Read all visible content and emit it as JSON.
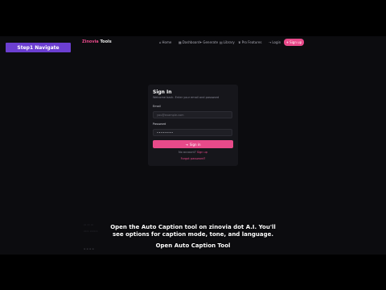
{
  "step": {
    "label": "Step1 Navigate"
  },
  "brand": {
    "part1": "Zinovia",
    "part2": "Tools"
  },
  "nav": {
    "links": [
      {
        "icon": "home-icon",
        "glyph": "⌂",
        "label": "Home"
      },
      {
        "icon": "dashboard-icon",
        "glyph": "▦",
        "label": "Dashboard"
      },
      {
        "icon": "generate-icon",
        "glyph": "✦",
        "label": "Generate"
      },
      {
        "icon": "library-icon",
        "glyph": "▤",
        "label": "Library"
      },
      {
        "icon": "pro-icon",
        "glyph": "♛",
        "label": "Pro Features"
      }
    ],
    "login": "Login",
    "signup": "Sign up"
  },
  "card": {
    "title": "Sign In",
    "subtitle": "Welcome back. Enter your email and password",
    "email_label": "Email",
    "email_placeholder": "you@example.com",
    "password_label": "Password",
    "password_value": "••••••••",
    "signin_label": "Sign in",
    "no_account_text": "No account?",
    "signup_link": "Sign up",
    "forgot_link": "Forgot password?"
  },
  "captions": {
    "line1": "Open the Auto Caption tool on zinovia dot A.I. You'll",
    "line2": "see options for caption mode, tone, and language.",
    "step_title": "Open Auto Caption Tool"
  },
  "colors": {
    "accent": "#e84a8a",
    "step_badge": "#6c3fd1",
    "background": "#0c0c0f",
    "card": "#16161b"
  }
}
